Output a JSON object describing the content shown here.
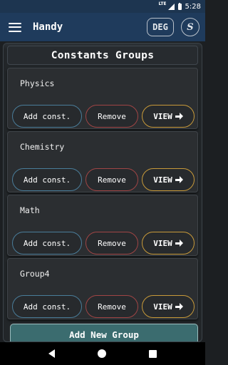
{
  "status_bar": {
    "network": "LTE",
    "time": "5:28"
  },
  "toolbar": {
    "title": "Handy",
    "angle_mode": "DEG",
    "s_label": "S"
  },
  "panel": {
    "title": "Constants Groups",
    "groups": [
      {
        "name": "Physics"
      },
      {
        "name": "Chemistry"
      },
      {
        "name": "Math"
      },
      {
        "name": "Group4"
      }
    ],
    "add_const_label": "Add const.",
    "remove_label": "Remove",
    "view_label": "VIEW",
    "add_group_label": "Add New Group"
  },
  "icons": {
    "menu": "hamburger-menu-icon",
    "view_arrow": "arrow-right-icon",
    "nav": [
      "back-icon",
      "home-icon",
      "recents-icon"
    ]
  },
  "colors": {
    "toolbar": "#1f3b5c",
    "add_border": "#4a7d9a",
    "remove_border": "#a04545",
    "view_border": "#c89a3a",
    "add_group_bg": "#3b6c6f"
  }
}
